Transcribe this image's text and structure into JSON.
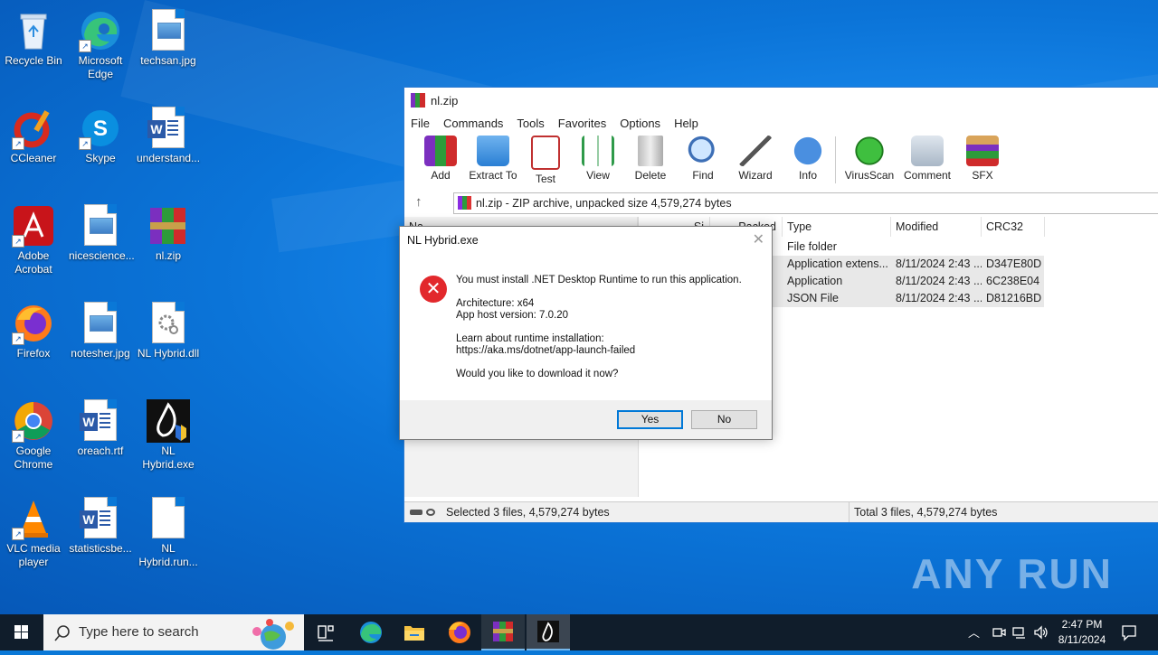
{
  "desktop": {
    "icons": [
      {
        "label": "Recycle Bin"
      },
      {
        "label": "Microsoft Edge"
      },
      {
        "label": "techsan.jpg"
      },
      {
        "label": "CCleaner"
      },
      {
        "label": "Skype"
      },
      {
        "label": "understand..."
      },
      {
        "label": "Adobe Acrobat"
      },
      {
        "label": "nicescience..."
      },
      {
        "label": "nl.zip"
      },
      {
        "label": "Firefox"
      },
      {
        "label": "notesher.jpg"
      },
      {
        "label": "NL Hybrid.dll"
      },
      {
        "label": "Google Chrome"
      },
      {
        "label": "oreach.rtf"
      },
      {
        "label": "NL Hybrid.exe"
      },
      {
        "label": "VLC media player"
      },
      {
        "label": "statisticsbe..."
      },
      {
        "label": "NL Hybrid.run..."
      }
    ]
  },
  "winrar": {
    "title": "nl.zip",
    "menu": [
      "File",
      "Commands",
      "Tools",
      "Favorites",
      "Options",
      "Help"
    ],
    "toolbar": [
      "Add",
      "Extract To",
      "Test",
      "View",
      "Delete",
      "Find",
      "Wizard",
      "Info",
      "VirusScan",
      "Comment",
      "SFX"
    ],
    "address": "nl.zip - ZIP archive, unpacked size 4,579,274 bytes",
    "columns": {
      "name": "Na",
      "size": "Si",
      "packed": "Packed",
      "type": "Type",
      "modified": "Modified",
      "crc": "CRC32"
    },
    "rows": [
      {
        "packed": "",
        "type": "File folder",
        "modified": "",
        "crc": ""
      },
      {
        "packed": "0",
        "type": "Application extens...",
        "modified": "8/11/2024 2:43 ...",
        "crc": "D347E80D"
      },
      {
        "packed": "5",
        "type": "Application",
        "modified": "8/11/2024 2:43 ...",
        "crc": "6C238E04"
      },
      {
        "packed": "7",
        "type": "JSON File",
        "modified": "8/11/2024 2:43 ...",
        "crc": "D81216BD"
      }
    ],
    "status_left": "Selected 3 files, 4,579,274 bytes",
    "status_right": "Total 3 files, 4,579,274 bytes"
  },
  "dialog": {
    "title": "NL Hybrid.exe",
    "line1": "You must install .NET Desktop Runtime to run this application.",
    "line2": "Architecture: x64",
    "line3": "App host version: 7.0.20",
    "line4": "Learn about runtime installation:",
    "line5": "https://aka.ms/dotnet/app-launch-failed",
    "line6": "Would you like to download it now?",
    "yes": "Yes",
    "no": "No"
  },
  "watermark": "ANY RUN",
  "taskbar": {
    "search_placeholder": "Type here to search",
    "time": "2:47 PM",
    "date": "8/11/2024"
  },
  "colors": {
    "accent": "#0078d7",
    "error": "#e2282c",
    "taskbar": "#101d2b"
  }
}
